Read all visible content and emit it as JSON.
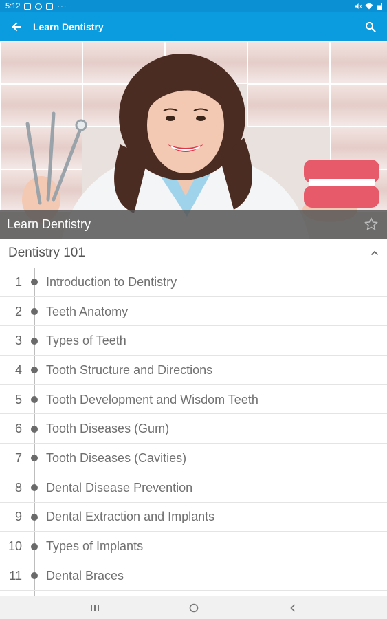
{
  "status_bar": {
    "time": "5:12",
    "overflow": "···"
  },
  "app_bar": {
    "title": "Learn Dentistry",
    "back_icon": "arrow-left-icon",
    "search_icon": "search-icon",
    "color": "#0b9cdf"
  },
  "hero": {
    "caption": "Learn Dentistry",
    "star_icon": "star-outline-icon"
  },
  "section": {
    "title": "Dentistry 101",
    "expand_icon": "chevron-up-icon"
  },
  "lessons": [
    {
      "num": "1",
      "title": "Introduction to Dentistry"
    },
    {
      "num": "2",
      "title": "Teeth Anatomy"
    },
    {
      "num": "3",
      "title": "Types of Teeth"
    },
    {
      "num": "4",
      "title": "Tooth Structure and Directions"
    },
    {
      "num": "5",
      "title": "Tooth Development and Wisdom Teeth"
    },
    {
      "num": "6",
      "title": "Tooth Diseases (Gum)"
    },
    {
      "num": "7",
      "title": "Tooth Diseases (Cavities)"
    },
    {
      "num": "8",
      "title": "Dental Disease Prevention"
    },
    {
      "num": "9",
      "title": "Dental Extraction and Implants"
    },
    {
      "num": "10",
      "title": "Types of Implants"
    },
    {
      "num": "11",
      "title": "Dental Braces"
    }
  ],
  "nav_bar": {
    "recents_icon": "recents-icon",
    "home_icon": "home-icon",
    "back_icon": "back-icon"
  }
}
